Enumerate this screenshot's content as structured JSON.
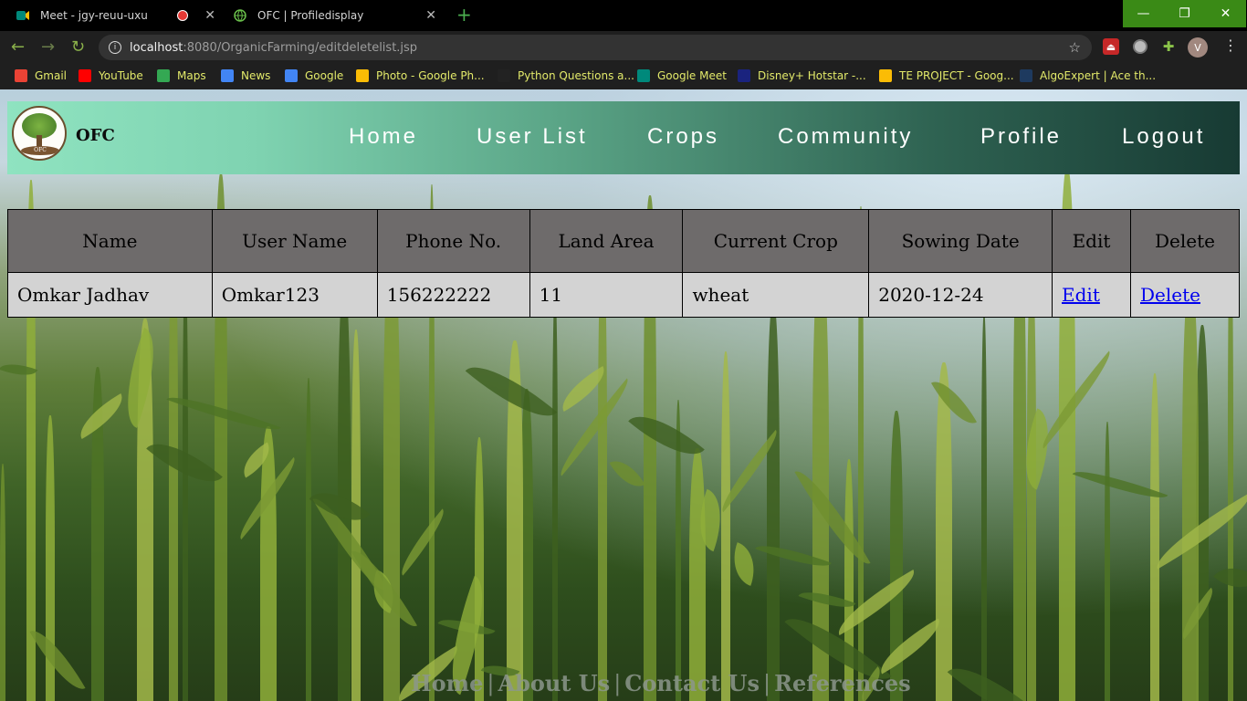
{
  "browser": {
    "tabs": [
      {
        "title": "Meet - jgy-reuu-uxu",
        "active": false,
        "recording": true
      },
      {
        "title": "OFC | Profiledisplay",
        "active": true
      }
    ],
    "new_tab": "+",
    "url_host": "localhost",
    "url_rest": ":8080/OrganicFarming/editdeletelist.jsp",
    "avatar_letter": "V",
    "bookmarks": [
      {
        "label": "Gmail",
        "icon": "gmail-icon",
        "color": "#ea4335"
      },
      {
        "label": "YouTube",
        "icon": "youtube-icon",
        "color": "#ff0000"
      },
      {
        "label": "Maps",
        "icon": "maps-icon",
        "color": "#34a853"
      },
      {
        "label": "News",
        "icon": "news-icon",
        "color": "#4285f4"
      },
      {
        "label": "Google",
        "icon": "google-icon",
        "color": "#4285f4"
      },
      {
        "label": "Photo - Google Ph...",
        "icon": "photos-icon",
        "color": "#fbbc05"
      },
      {
        "label": "Python Questions a...",
        "icon": "sf-icon",
        "color": "#222222"
      },
      {
        "label": "Google Meet",
        "icon": "meet-icon",
        "color": "#00897b"
      },
      {
        "label": "Disney+ Hotstar -...",
        "icon": "hotstar-icon",
        "color": "#1a237e"
      },
      {
        "label": "TE PROJECT - Goog...",
        "icon": "drive-icon",
        "color": "#fbbc05"
      },
      {
        "label": "AlgoExpert | Ace th...",
        "icon": "algoexpert-icon",
        "color": "#1e3a5f"
      }
    ]
  },
  "site": {
    "brand": "OFC",
    "logo_text": "OFC",
    "nav": [
      "Home",
      "User List",
      "Crops",
      "Community",
      "Profile",
      "Logout"
    ]
  },
  "table": {
    "headers": [
      "Name",
      "User Name",
      "Phone No.",
      "Land Area",
      "Current Crop",
      "Sowing Date",
      "Edit",
      "Delete"
    ],
    "rows": [
      [
        "Omkar Jadhav",
        "Omkar123",
        "156222222",
        "11",
        "wheat",
        "2020-12-24",
        "Edit",
        "Delete"
      ]
    ]
  },
  "footer": {
    "links": [
      "Home",
      "About Us",
      "Contact Us",
      "References"
    ],
    "separator": "|"
  }
}
